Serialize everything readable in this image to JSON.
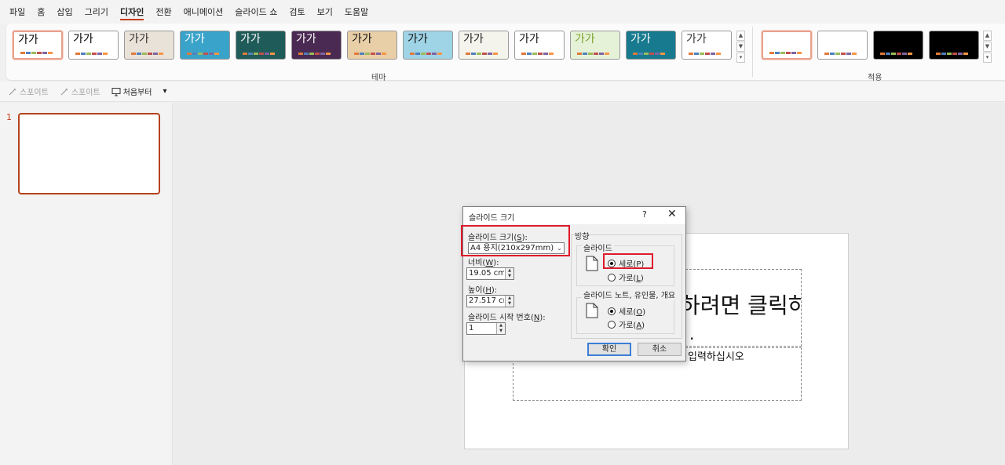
{
  "menu": [
    "파일",
    "홈",
    "삽입",
    "그리기",
    "디자인",
    "전환",
    "애니메이션",
    "슬라이드 쇼",
    "검토",
    "보기",
    "도움말"
  ],
  "menu_active": "디자인",
  "ribbon": {
    "theme_group_label": "테마",
    "variant_group_label": "적용",
    "theme_thumb_text": "가가",
    "scroll_up": "▲",
    "scroll_down": "▼",
    "scroll_more": "▾"
  },
  "themes": [
    {
      "bg": "#ffffff",
      "fg": "#000000"
    },
    {
      "bg": "#ffffff",
      "fg": "#000000"
    },
    {
      "bg": "#e9e2d8",
      "fg": "#333333"
    },
    {
      "bg": "#3aa3c9",
      "fg": "#ffffff"
    },
    {
      "bg": "#1f5b58",
      "fg": "#ffffff"
    },
    {
      "bg": "#4a2a52",
      "fg": "#ffffff"
    },
    {
      "bg": "#e9cfa7",
      "fg": "#111111"
    },
    {
      "bg": "#9fd3e6",
      "fg": "#111111"
    },
    {
      "bg": "#f4f4ec",
      "fg": "#222222"
    },
    {
      "bg": "#ffffff",
      "fg": "#111111"
    },
    {
      "bg": "#e6f2d8",
      "fg": "#7aa32f"
    },
    {
      "bg": "#177a8f",
      "fg": "#ffffff"
    },
    {
      "bg": "#ffffff",
      "fg": "#333333"
    }
  ],
  "variants": [
    "#ffffff",
    "#ffffff",
    "#000000",
    "#000000"
  ],
  "accent_colors": [
    "#e07a3a",
    "#4f81bd",
    "#9bbb59",
    "#c0504d",
    "#8064a2",
    "#f79646"
  ],
  "qat": {
    "eyedropper1": "스포이트",
    "eyedropper2": "스포이트",
    "from_start": "처음부터",
    "more": "▾"
  },
  "slide_panel": {
    "number": "1"
  },
  "slide": {
    "title_text": "하려면 클릭하",
    "title_dot": ".",
    "subtitle_text": "입력하십시오"
  },
  "dialog": {
    "title": "슬라이드 크기",
    "help": "?",
    "close": "✕",
    "size_label": "슬라이드 크기(",
    "size_key": "S",
    "size_label_end": "):",
    "size_value": "A4 용지(210x297mm)",
    "width_label": "너비(",
    "width_key": "W",
    "width_label_end": "):",
    "width_value": "19.05 cm",
    "height_label": "높이(",
    "height_key": "H",
    "height_label_end": "):",
    "height_value": "27.517 cm",
    "start_label": "슬라이드 시작 번호(",
    "start_key": "N",
    "start_label_end": "):",
    "start_value": "1",
    "orientation_label": "방향",
    "slides_label": "슬라이드",
    "slides_portrait": "세로(",
    "slides_portrait_key": "P",
    "slides_landscape": "가로(",
    "slides_landscape_key": "L",
    "notes_label": "슬라이드 노트, 유인물, 개요",
    "notes_portrait": "세로(",
    "notes_portrait_key": "O",
    "notes_landscape": "가로(",
    "notes_landscape_key": "A",
    "paren_close": ")",
    "ok": "확인",
    "cancel": "취소",
    "spin_up": "▲",
    "spin_down": "▼",
    "select_arrow": "⌄"
  }
}
